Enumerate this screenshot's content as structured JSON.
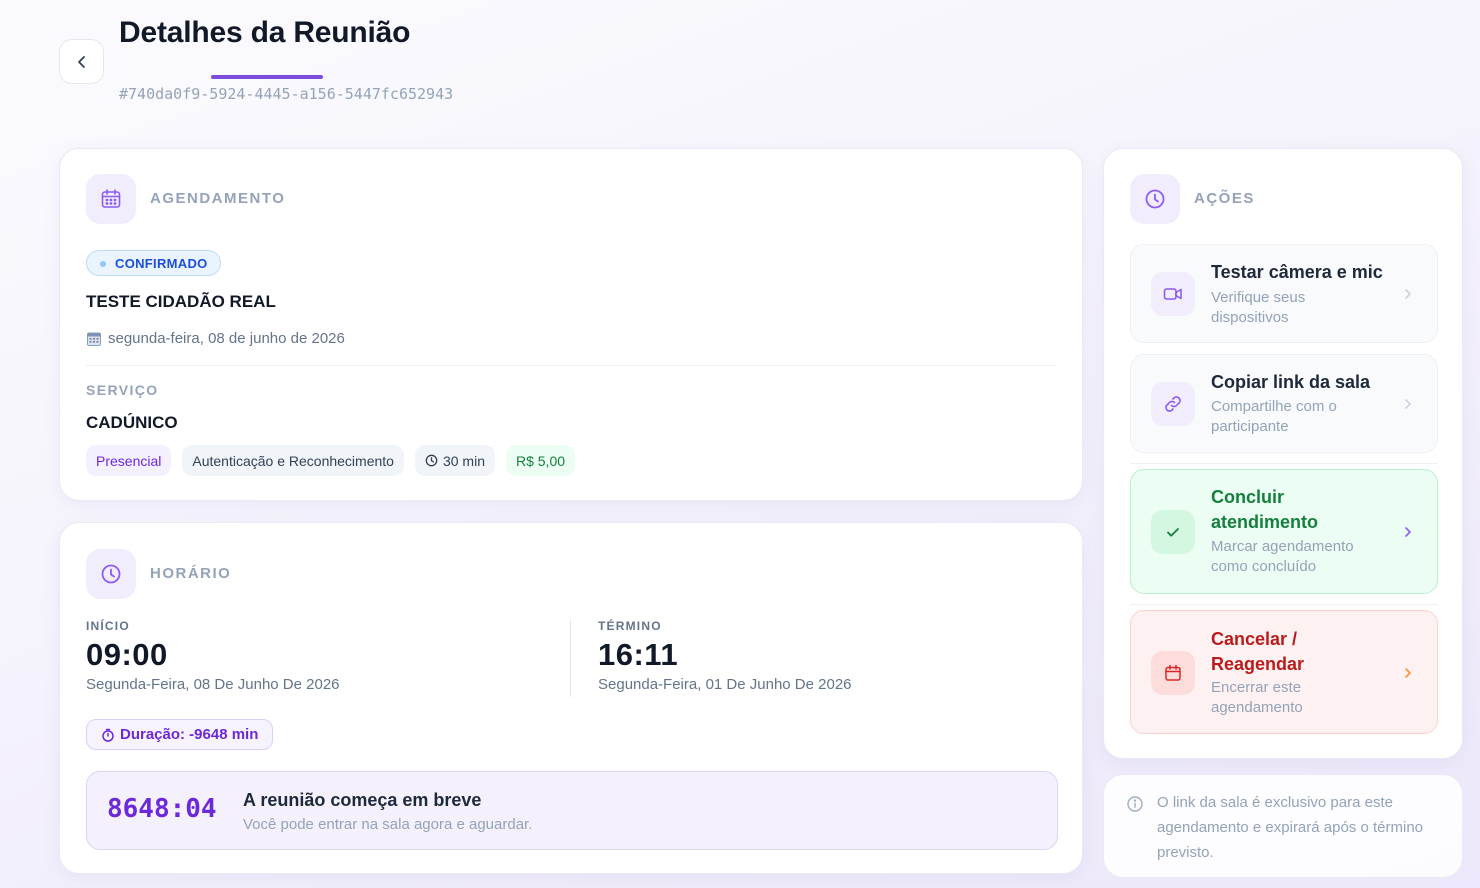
{
  "header": {
    "title": "Detalhes da Reunião",
    "meeting_id": "#740da0f9-5924-4445-a156-5447fc652943"
  },
  "agendamento": {
    "section_title": "AGENDAMENTO",
    "status": "CONFIRMADO",
    "client_name": "TESTE CIDADÃO REAL",
    "date": "segunda-feira, 08 de junho de 2026",
    "service_label": "SERVIÇO",
    "service_name": "CADÚNICO",
    "chips": {
      "modality": "Presencial",
      "category": "Autenticação e Reconhecimento",
      "duration": "30 min",
      "price": "R$ 5,00"
    }
  },
  "horario": {
    "section_title": "HORÁRIO",
    "start_label": "INÍCIO",
    "start_time": "09:00",
    "start_date": "Segunda-Feira, 08 De Junho De 2026",
    "end_label": "TÉRMINO",
    "end_time": "16:11",
    "end_date": "Segunda-Feira, 01 De Junho De 2026",
    "duration": "Duração: -9648 min",
    "countdown": "8648:04",
    "countdown_title": "A reunião começa em breve",
    "countdown_subtitle": "Você pode entrar na sala agora e aguardar."
  },
  "acoes": {
    "section_title": "AÇÕES",
    "items": [
      {
        "title": "Testar câmera e mic",
        "subtitle": "Verifique seus dispositivos"
      },
      {
        "title": "Copiar link da sala",
        "subtitle": "Compartilhe com o participante"
      },
      {
        "title": "Concluir atendimento",
        "subtitle": "Marcar agendamento como concluído"
      },
      {
        "title": "Cancelar / Reagendar",
        "subtitle": "Encerrar este agendamento"
      }
    ]
  },
  "info": {
    "text": "O link da sala é exclusivo para este agendamento e expirará após o término previsto."
  },
  "colors": {
    "accent": "#7c4ddb",
    "confirm_blue": "#1d4ed8",
    "success_green": "#15803d",
    "danger_red": "#b91c1c"
  },
  "icons": {
    "back": "chevron-left-icon",
    "agendamento": "calendar-icon",
    "horario": "clock-icon",
    "acoes": "clock-icon",
    "camera": "video-camera-icon",
    "link": "link-icon",
    "check": "check-icon",
    "cancel": "calendar-icon",
    "info": "info-icon"
  }
}
